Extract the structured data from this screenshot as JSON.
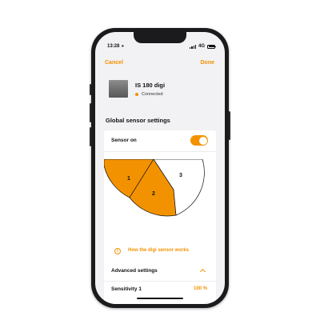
{
  "status_bar": {
    "time": "13:28",
    "network": "4G"
  },
  "nav": {
    "cancel_label": "Cancel",
    "done_label": "Done"
  },
  "device": {
    "name": "IS 180 digi",
    "status": "Connected"
  },
  "section_title": "Global sensor settings",
  "sensor": {
    "label": "Sensor on",
    "enabled": true
  },
  "zones": {
    "labels": [
      "1",
      "2",
      "3"
    ],
    "active": [
      "1",
      "2"
    ]
  },
  "info_link": {
    "icon": "info-icon",
    "label": "How the digi sensor works"
  },
  "advanced": {
    "label": "Advanced settings",
    "expanded": true
  },
  "sensitivity": {
    "label": "Sensitivity 1",
    "value_text": "100 %",
    "value": 1.0
  },
  "colors": {
    "accent": "#f39200",
    "background": "#f2f2f4",
    "card": "#ffffff"
  }
}
